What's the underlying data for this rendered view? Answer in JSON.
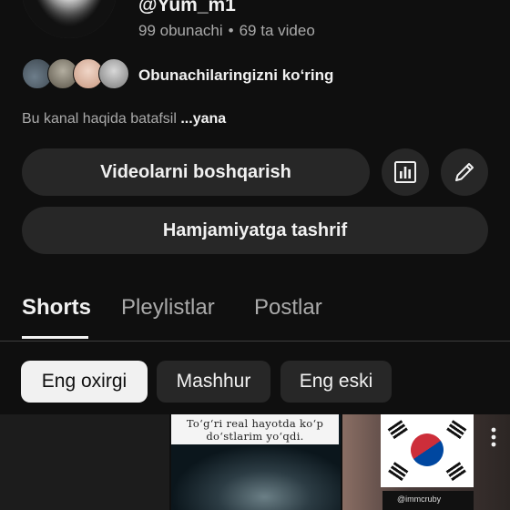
{
  "channel": {
    "handle": "@Yum_m1",
    "subscribers": "99 obunachi",
    "separator": "•",
    "videos": "69 ta video"
  },
  "subscribers_row": {
    "label": "Obunachilaringizni ko‘ring"
  },
  "about": {
    "text": "Bu kanal haqida batafsil",
    "more": "...yana"
  },
  "actions": {
    "manage_label": "Videolarni boshqarish",
    "stats_icon": "analytics-icon",
    "edit_icon": "pencil-icon",
    "community_label": "Hamjamiyatga tashrif"
  },
  "tabs": [
    {
      "label": "Shorts",
      "active": true
    },
    {
      "label": "Pleylistlar",
      "active": false
    },
    {
      "label": "Postlar",
      "active": false
    }
  ],
  "filters": [
    {
      "label": "Eng oxirgi",
      "active": true
    },
    {
      "label": "Mashhur",
      "active": false
    },
    {
      "label": "Eng eski",
      "active": false
    }
  ],
  "thumbnails": [
    {
      "caption": ""
    },
    {
      "caption": "To‘g‘ri real hayotda ko‘p do‘stlarim yo‘qdi."
    },
    {
      "watermark": "@immcruby"
    }
  ],
  "colors": {
    "background": "#0f0f0f",
    "button": "#272727",
    "text_primary": "#f1f1f1",
    "text_secondary": "#aaaaaa",
    "flag_red": "#cd2e3a",
    "flag_blue": "#0047a0"
  }
}
